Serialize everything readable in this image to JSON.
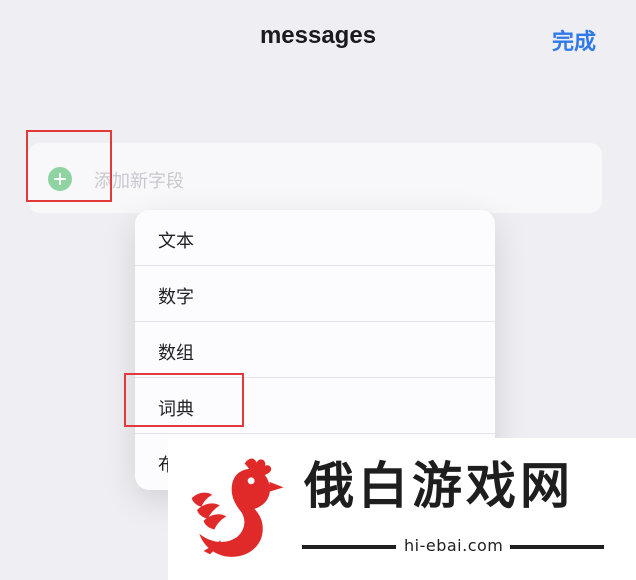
{
  "header": {
    "title": "messages",
    "done_label": "完成"
  },
  "field_row": {
    "placeholder": "添加新字段"
  },
  "menu": {
    "items": [
      {
        "label": "文本"
      },
      {
        "label": "数字"
      },
      {
        "label": "数组"
      },
      {
        "label": "词典"
      },
      {
        "label": "布"
      }
    ]
  },
  "watermark": {
    "title": "俄白游戏网",
    "url": "hi-ebai.com"
  },
  "colors": {
    "accent": "#2f79ea",
    "highlight": "#e23a3a",
    "plus": "#8fd3a0",
    "rooster": "#e02a2a"
  },
  "icons": {
    "add": "plus-circle-icon",
    "logo": "rooster-logo"
  }
}
